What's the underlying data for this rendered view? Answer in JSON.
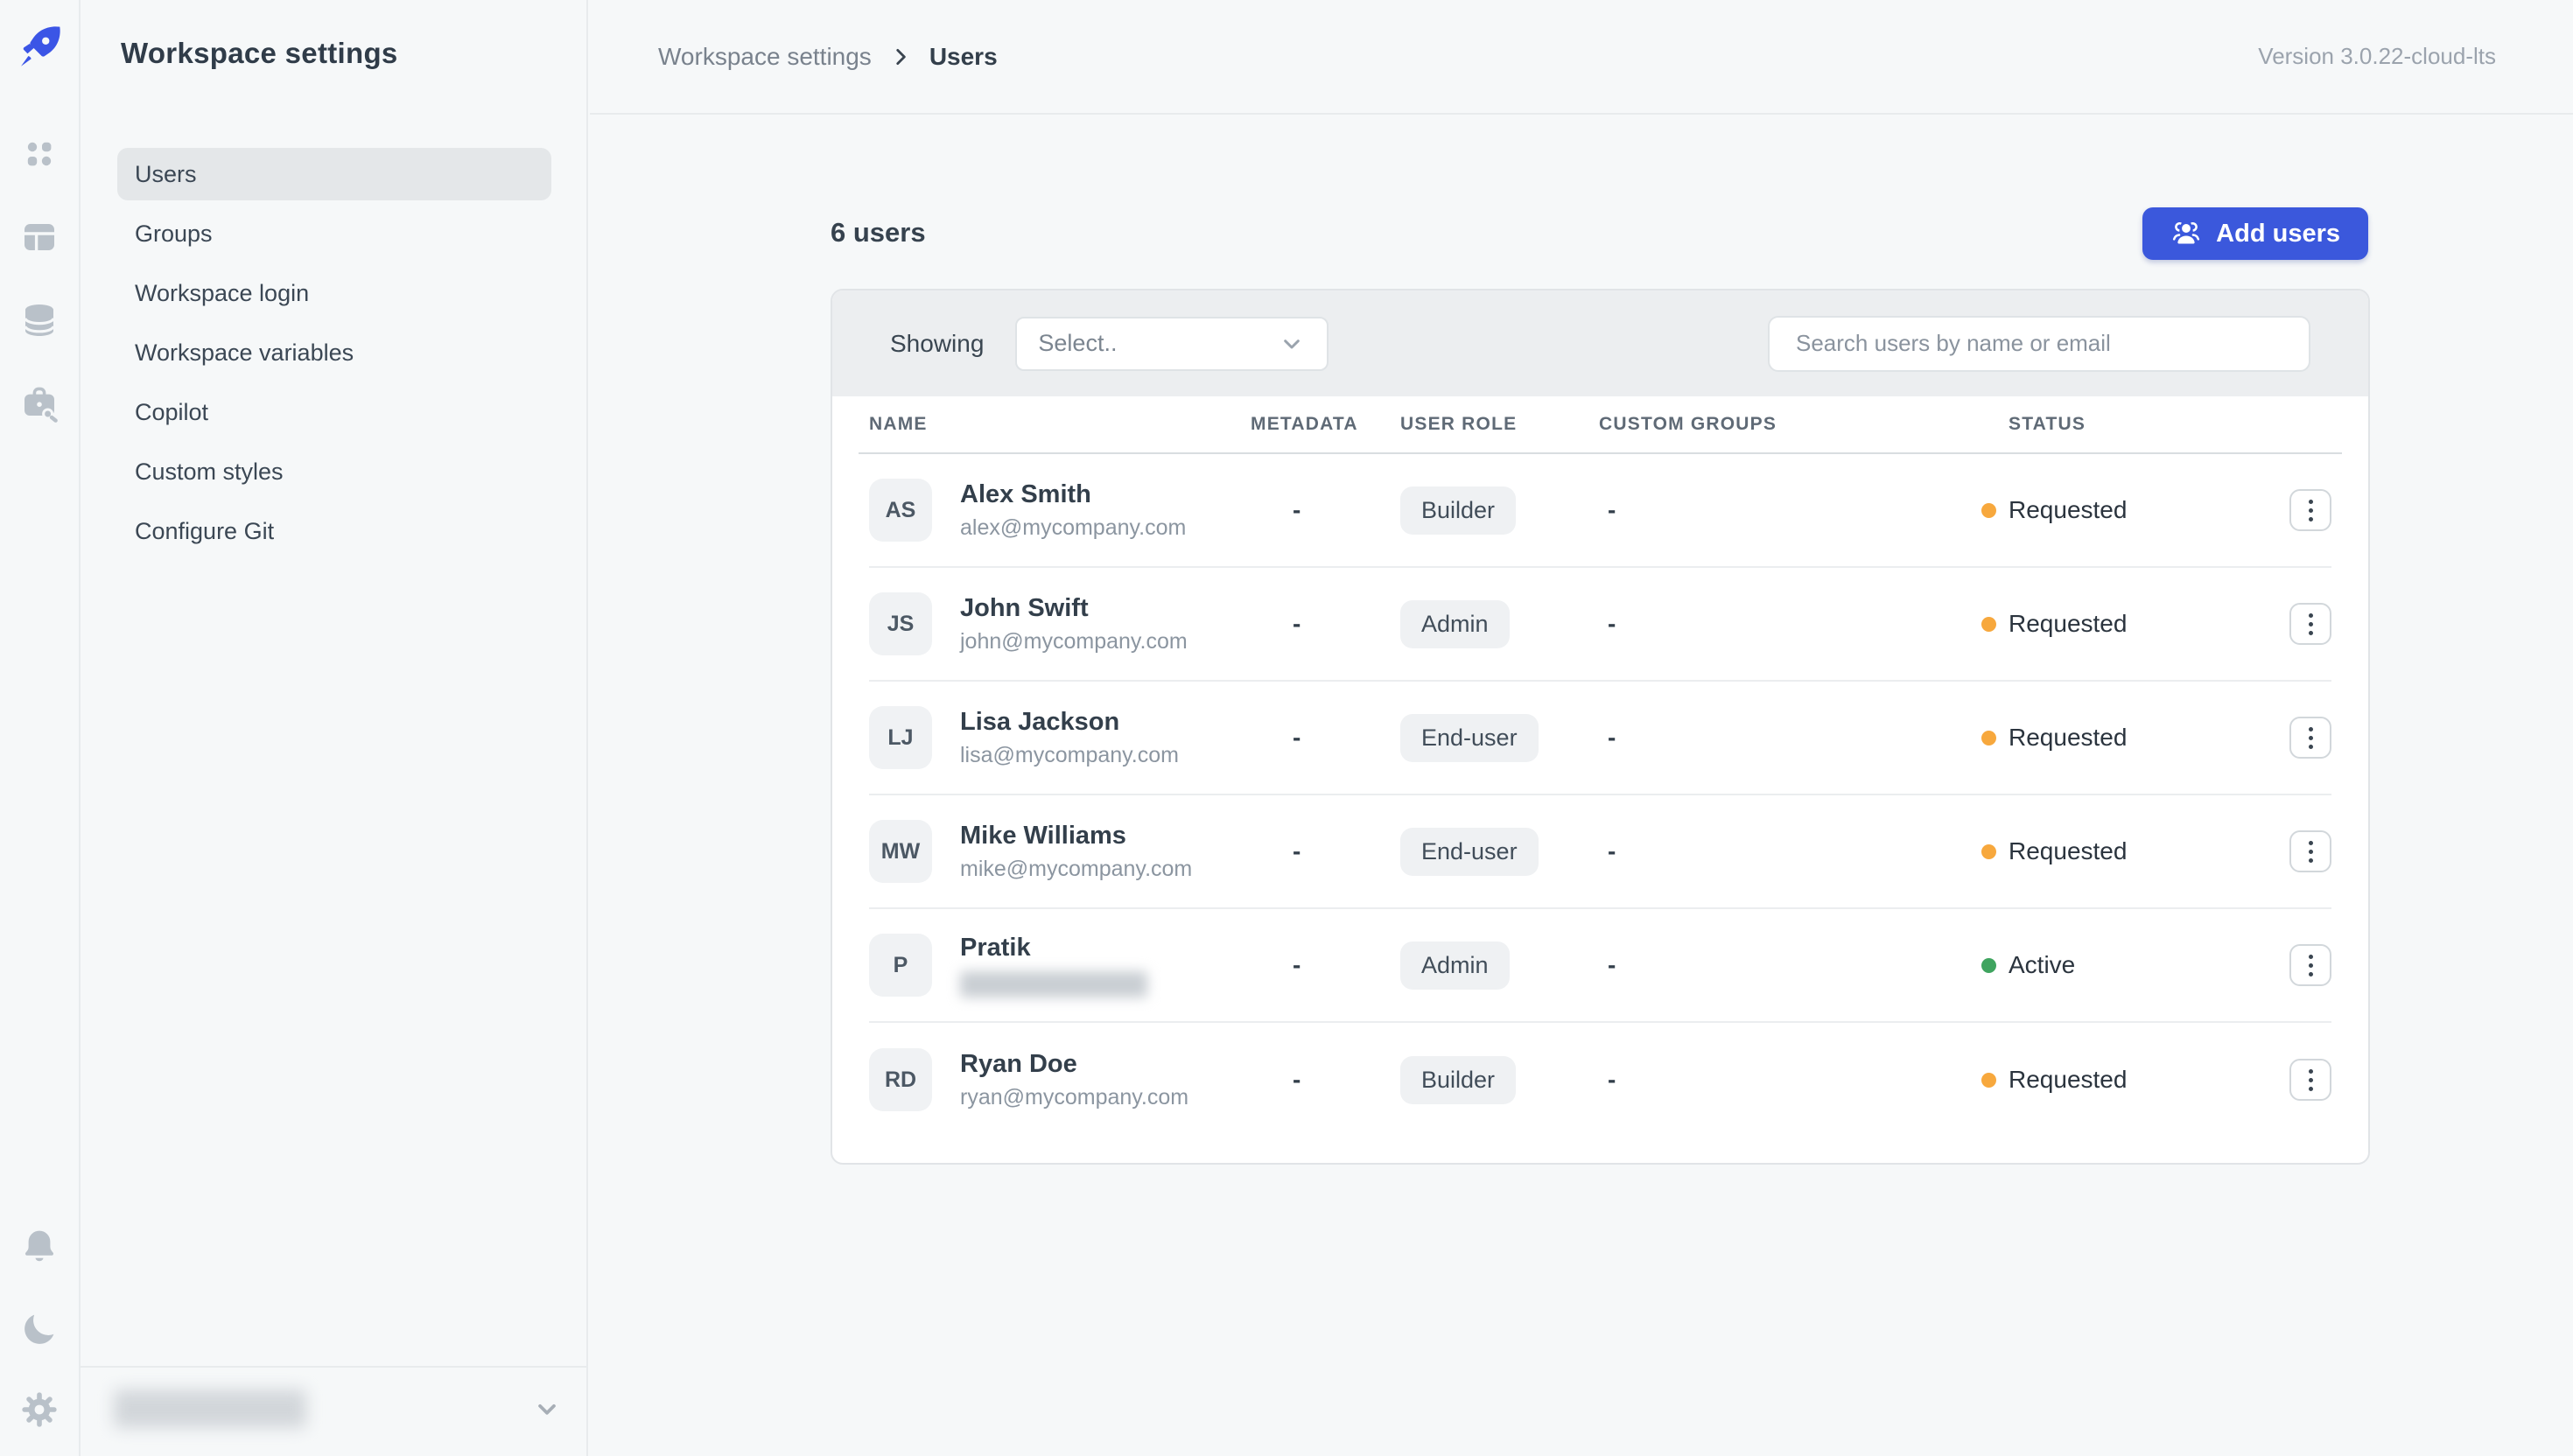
{
  "colors": {
    "logo_blue": "#3b55e6",
    "button_blue": "#3b58dc",
    "orange": "#f7a83d",
    "green": "#3fa45f"
  },
  "rail": {
    "icons": [
      "rocket-logo",
      "apps-grid",
      "layout",
      "datasources",
      "package",
      "notifications",
      "dark-mode",
      "settings"
    ]
  },
  "sidebar": {
    "title": "Workspace settings",
    "items": [
      {
        "label": "Users",
        "active": true
      },
      {
        "label": "Groups",
        "active": false
      },
      {
        "label": "Workspace login",
        "active": false
      },
      {
        "label": "Workspace variables",
        "active": false
      },
      {
        "label": "Copilot",
        "active": false
      },
      {
        "label": "Custom styles",
        "active": false
      },
      {
        "label": "Configure Git",
        "active": false
      }
    ]
  },
  "breadcrumb": {
    "parent": "Workspace settings",
    "current": "Users"
  },
  "version": "Version 3.0.22-cloud-lts",
  "content": {
    "user_count": "6 users",
    "add_users_label": "Add users",
    "showing_label": "Showing",
    "select_placeholder": "Select..",
    "search_placeholder": "Search users by name or email",
    "columns": [
      "NAME",
      "METADATA",
      "USER ROLE",
      "CUSTOM GROUPS",
      "STATUS"
    ],
    "rows": [
      {
        "initials": "AS",
        "name": "Alex Smith",
        "email": "alex@mycompany.com",
        "email_redacted": false,
        "metadata": "-",
        "role": "Builder",
        "custom_groups": "-",
        "status": "Requested",
        "status_color": "orange"
      },
      {
        "initials": "JS",
        "name": "John Swift",
        "email": "john@mycompany.com",
        "email_redacted": false,
        "metadata": "-",
        "role": "Admin",
        "custom_groups": "-",
        "status": "Requested",
        "status_color": "orange"
      },
      {
        "initials": "LJ",
        "name": "Lisa Jackson",
        "email": "lisa@mycompany.com",
        "email_redacted": false,
        "metadata": "-",
        "role": "End-user",
        "custom_groups": "-",
        "status": "Requested",
        "status_color": "orange"
      },
      {
        "initials": "MW",
        "name": "Mike Williams",
        "email": "mike@mycompany.com",
        "email_redacted": false,
        "metadata": "-",
        "role": "End-user",
        "custom_groups": "-",
        "status": "Requested",
        "status_color": "orange"
      },
      {
        "initials": "P",
        "name": "Pratik",
        "email": "",
        "email_redacted": true,
        "metadata": "-",
        "role": "Admin",
        "custom_groups": "-",
        "status": "Active",
        "status_color": "green"
      },
      {
        "initials": "RD",
        "name": "Ryan Doe",
        "email": "ryan@mycompany.com",
        "email_redacted": false,
        "metadata": "-",
        "role": "Builder",
        "custom_groups": "-",
        "status": "Requested",
        "status_color": "orange"
      }
    ]
  }
}
